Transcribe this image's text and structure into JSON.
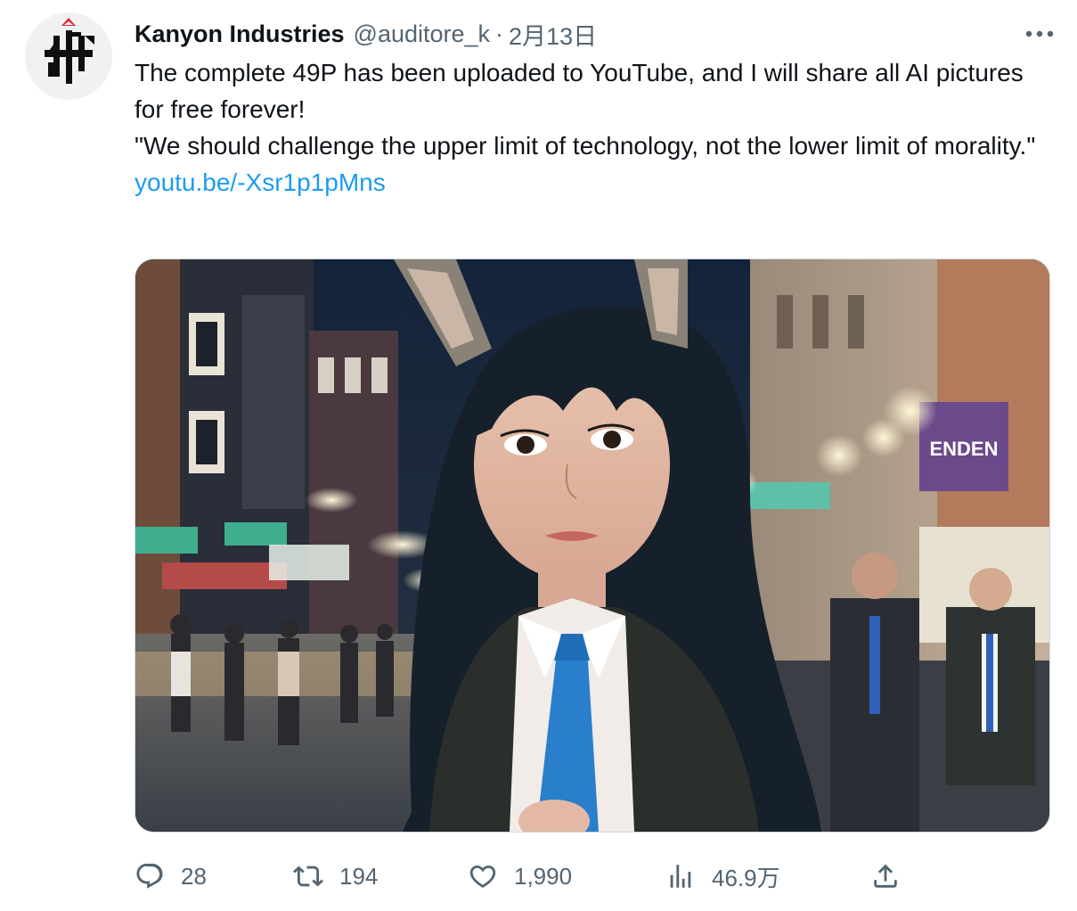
{
  "author": {
    "name": "Kanyon Industries",
    "handle": "@auditore_k",
    "separator": "·",
    "date": "2月13日"
  },
  "tweet": {
    "line1": "The complete 49P has been uploaded to YouTube, and I will share all AI pictures for free forever!",
    "line2": "\"We should challenge the upper limit of technology, not the lower limit of morality.\"",
    "link": "youtu.be/-Xsr1p1pMns"
  },
  "media": {
    "sign_text": "ENDEN"
  },
  "actions": {
    "replies": "28",
    "retweets": "194",
    "likes": "1,990",
    "views": "46.9万"
  },
  "icons": {
    "more": "more-icon",
    "reply": "reply-icon",
    "retweet": "retweet-icon",
    "like": "like-icon",
    "views": "views-icon",
    "share": "share-icon"
  },
  "colors": {
    "text": "#0f1419",
    "secondary": "#536471",
    "link": "#1d9bf0",
    "logo_red": "#e0262b"
  }
}
